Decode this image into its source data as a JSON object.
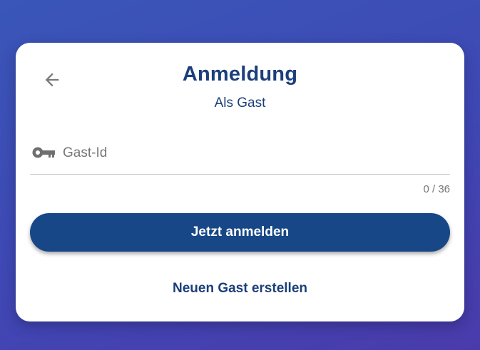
{
  "card": {
    "title": "Anmeldung",
    "subtitle": "Als Gast"
  },
  "back": {
    "icon": "arrow-back-icon"
  },
  "guest_id_field": {
    "icon": "key-icon",
    "placeholder": "Gast-Id",
    "value": "",
    "counter": "0 / 36"
  },
  "actions": {
    "login_label": "Jetzt anmelden",
    "create_guest_label": "Neuen Gast erstellen"
  },
  "colors": {
    "primary": "#174786",
    "title_text": "#1b3f7a",
    "background_start": "#3a56b8",
    "background_end": "#4a3bab"
  }
}
